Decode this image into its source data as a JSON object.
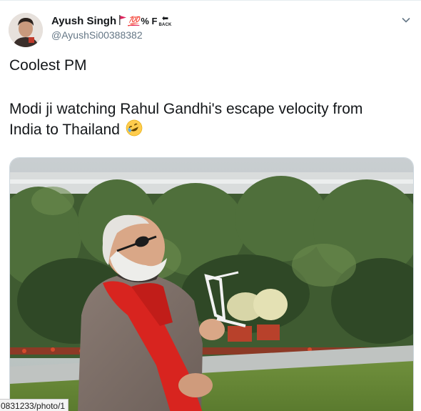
{
  "user": {
    "display_name": "Ayush Singh",
    "badge_hundred": "💯",
    "badge_percent": "% F",
    "back_label": "BACK",
    "handle": "@AyushSi00388382"
  },
  "tweet": {
    "line1": "Coolest PM",
    "line2": "Modi ji watching Rahul Gandhi's escape velocity from",
    "line3": "India to Thailand",
    "emoji": "rolling-on-the-floor-laughing"
  },
  "icons": {
    "caret": "chevron-down-icon",
    "flag": "red-flag-icon",
    "back": "back-arrow-icon"
  },
  "status_bar": {
    "url_fragment": "0831233/photo/1"
  },
  "colors": {
    "secondary_text": "#657786",
    "badge_red": "#e0245e",
    "border": "#e6ecf0"
  }
}
